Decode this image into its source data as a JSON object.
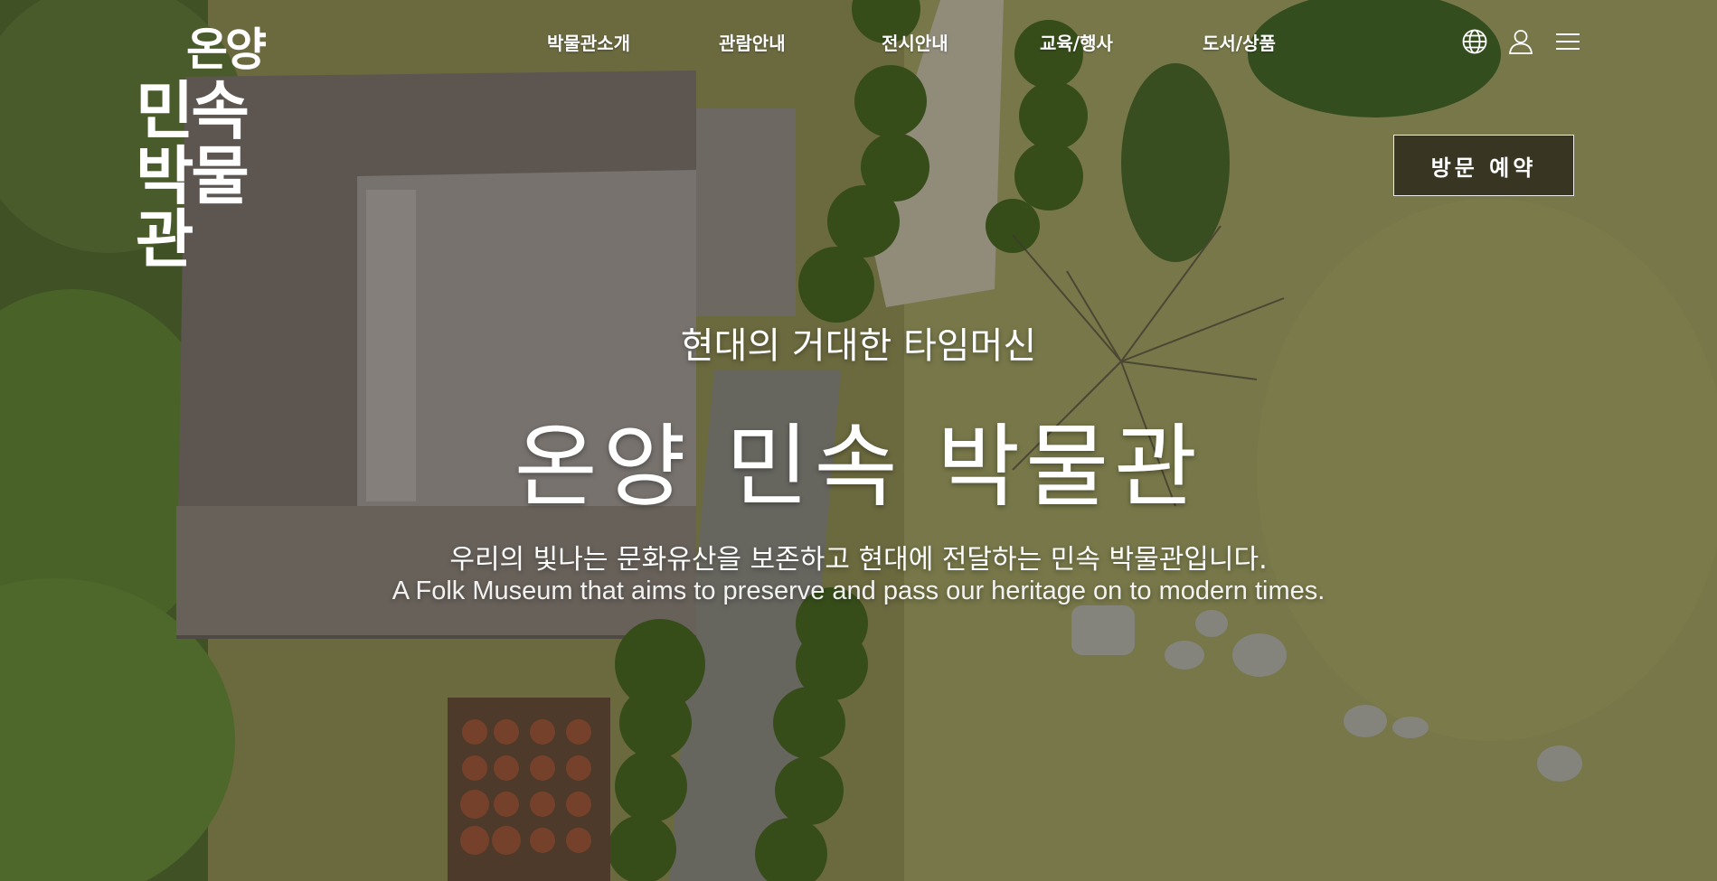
{
  "logo": {
    "line1": "온양",
    "line2": "민속",
    "line3": "박물관"
  },
  "nav": {
    "items": [
      {
        "label": "박물관소개"
      },
      {
        "label": "관람안내"
      },
      {
        "label": "전시안내"
      },
      {
        "label": "교육/행사"
      },
      {
        "label": "도서/상품"
      }
    ]
  },
  "utility": {
    "icons": [
      "globe-icon",
      "user-icon",
      "menu-icon"
    ]
  },
  "cta": {
    "reserve_label": "방문 예약"
  },
  "hero": {
    "subtitle": "현대의 거대한 타임머신",
    "title": "온양 민속 박물관",
    "desc_ko": "우리의 빛나는 문화유산을 보존하고 현대에 전달하는 민속 박물관입니다.",
    "desc_en": "A Folk Museum that aims to preserve and pass our heritage on to modern times."
  },
  "colors": {
    "text": "#ffffff",
    "button_bg": "#2b2318",
    "grass": "#8a8a52",
    "roof": "#7b7268",
    "tree": "#4d6b2f"
  }
}
